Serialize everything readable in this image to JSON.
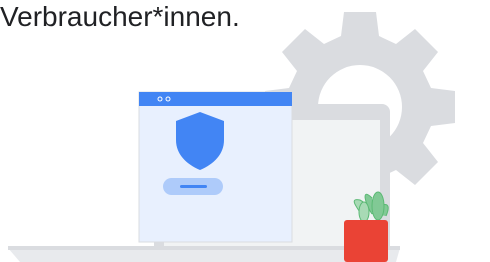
{
  "headline": {
    "text": "Verbraucher*innen."
  },
  "illustration": {
    "icons": [
      "gear-icon",
      "laptop-icon",
      "browser-window-icon",
      "shield-icon",
      "button-icon",
      "plant-pot-icon"
    ],
    "colors": {
      "gear": "#dadce0",
      "laptop_frame": "#dadce0",
      "laptop_screen": "#f1f3f4",
      "window_titlebar": "#4285f4",
      "window_body": "#e8f0fe",
      "shield": "#4285f4",
      "button": "#aecbfa",
      "button_line": "#4285f4",
      "pot": "#ea4335",
      "plant": "#81c995"
    }
  }
}
